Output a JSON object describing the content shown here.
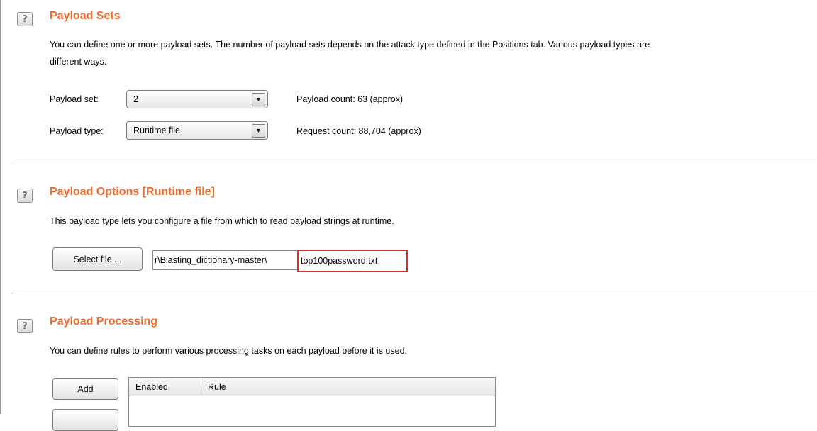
{
  "payload_sets": {
    "title": "Payload Sets",
    "description_line1": "You can define one or more payload sets. The number of payload sets depends on the attack type defined in the Positions tab. Various payload types are",
    "description_line2": "different ways.",
    "payload_set_label": "Payload set:",
    "payload_set_value": "2",
    "payload_type_label": "Payload type:",
    "payload_type_value": "Runtime file",
    "payload_count": "Payload count:  63 (approx)",
    "request_count": "Request count:  88,704 (approx)"
  },
  "payload_options": {
    "title": "Payload Options [Runtime file]",
    "description": "This payload type lets you configure a file from which to read payload strings at runtime.",
    "select_file_label": "Select file ...",
    "file_path_prefix": "r\\Blasting_dictionary-master\\",
    "file_path_highlighted": "top100password.txt"
  },
  "payload_processing": {
    "title": "Payload Processing",
    "description": "You can define rules to perform various processing tasks on each payload before it is used.",
    "add_label": "Add",
    "columns": [
      "Enabled",
      "Rule"
    ]
  },
  "colors": {
    "section_title": "#f26b2e",
    "highlight_box": "#d32f2f"
  },
  "icons": {
    "help": "help-question-icon",
    "dropdown": "triangle-down-icon"
  },
  "help_glyph": "?",
  "dropdown_glyph": "▼"
}
